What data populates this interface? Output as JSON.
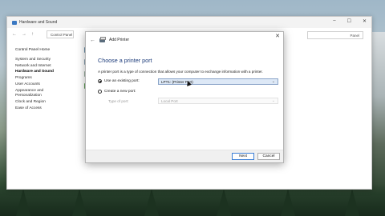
{
  "control_panel": {
    "title": "Hardware and Sound",
    "address": "Control Panel",
    "search_text": "Panel",
    "window_controls": [
      "–",
      "☐",
      "✕"
    ],
    "sidebar": [
      {
        "label": "Control Panel Home",
        "style": "cat"
      },
      {
        "label": "System and Security",
        "style": "cat"
      },
      {
        "label": "Network and Internet",
        "style": "cat"
      },
      {
        "label": "Hardware and Sound",
        "style": "bold"
      },
      {
        "label": "Programs",
        "style": "cat"
      },
      {
        "label": "User Accounts",
        "style": "cat"
      },
      {
        "label": "Appearance and Personalization",
        "style": "cat"
      },
      {
        "label": "Clock and Region",
        "style": "cat"
      },
      {
        "label": "Ease of Access",
        "style": "cat"
      }
    ]
  },
  "dialog": {
    "title": "Add Printer",
    "close_glyph": "✕",
    "back_glyph": "←",
    "heading": "Choose a printer port",
    "description": "A printer port is a type of connection that allows your computer to exchange information with a printer.",
    "option_existing_label": "Use an existing port:",
    "existing_port_value": "LPT1: (Printer Port)",
    "option_new_label": "Create a new port:",
    "type_label": "Type of port:",
    "type_value": "Local Port",
    "next_label": "Next",
    "cancel_label": "Cancel",
    "selected_option": "existing"
  },
  "colors": {
    "heading": "#1c3b7a",
    "selection_bg": "#dde8f6",
    "accent": "#3c7fd6"
  }
}
